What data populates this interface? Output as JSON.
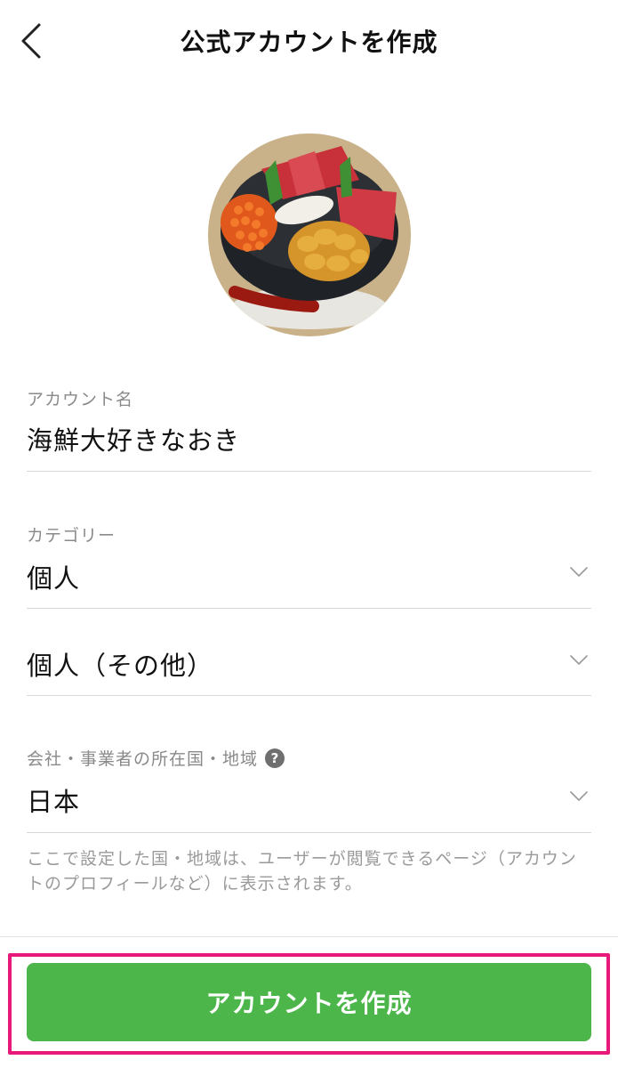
{
  "header": {
    "title": "公式アカウントを作成",
    "back_icon": "chevron-left-icon"
  },
  "form": {
    "account_name": {
      "label": "アカウント名",
      "value": "海鮮大好きなおき"
    },
    "category": {
      "label": "カテゴリー",
      "value": "個人"
    },
    "subcategory": {
      "value": "個人（その他）"
    },
    "country": {
      "label": "会社・事業者の所在国・地域",
      "help_text": "?",
      "value": "日本"
    },
    "note": "ここで設定した国・地域は、ユーザーが閲覧できるページ（アカウントのプロフィールなど）に表示されます。"
  },
  "footer": {
    "create_button_label": "アカウントを作成"
  },
  "colors": {
    "primary_green": "#4cb64a",
    "highlight_pink": "#e8197a",
    "label_gray": "#8a8a8a",
    "divider": "#d8d8d8"
  }
}
